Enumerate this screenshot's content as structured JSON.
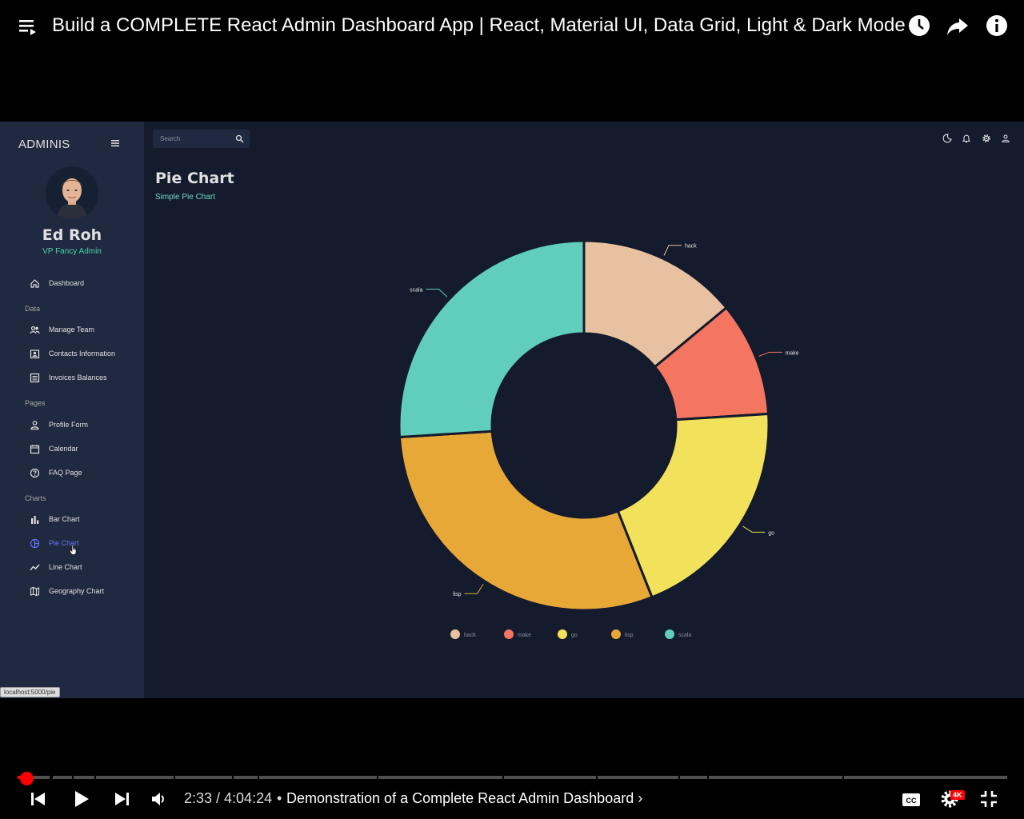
{
  "player": {
    "video_title": "Build a COMPLETE React Admin Dashboard App | React, Material UI, Data Grid, Light & Dark Mode",
    "time_current": "2:33",
    "time_total": "4:04:24",
    "time_display": "2:33 / 4:04:24",
    "separator": "•",
    "chapter_title": "Demonstration of a Complete React Admin Dashboard ›",
    "quality_badge": "4K",
    "progress_fraction": 0.0105,
    "accent_color": "#ff0000"
  },
  "app": {
    "brand": "ADMINIS",
    "user": {
      "name": "Ed Roh",
      "role": "VP Fancy Admin"
    },
    "search": {
      "placeholder": "Search",
      "value": ""
    },
    "menu": {
      "dashboard": "Dashboard",
      "section_data": "Data",
      "manage_team": "Manage Team",
      "contacts": "Contacts Information",
      "invoices": "Invoices Balances",
      "section_pages": "Pages",
      "profile_form": "Profile Form",
      "calendar": "Calendar",
      "faq": "FAQ Page",
      "section_charts": "Charts",
      "bar_chart": "Bar Chart",
      "pie_chart": "Pie Chart",
      "line_chart": "Line Chart",
      "geography_chart": "Geography Chart"
    },
    "active_item": "Pie Chart",
    "page": {
      "title": "Pie Chart",
      "subtitle": "Simple Pie Chart"
    },
    "status_url": "localhost:5000/pie",
    "colors": {
      "background": "#141b2d",
      "sidebar": "#1f2a40",
      "accent_green": "#4cceac",
      "active_blue": "#6870fa"
    }
  },
  "chart_data": {
    "type": "pie",
    "donut": true,
    "categories": [
      "hack",
      "make",
      "go",
      "lisp",
      "scala"
    ],
    "values": [
      14,
      10,
      20,
      30,
      26
    ],
    "colors": [
      "#e8c1a0",
      "#f47560",
      "#f1e15b",
      "#e8a838",
      "#61cdbb"
    ],
    "legend": [
      "hack",
      "make",
      "go",
      "lisp",
      "scala"
    ],
    "legend_position": "bottom"
  }
}
